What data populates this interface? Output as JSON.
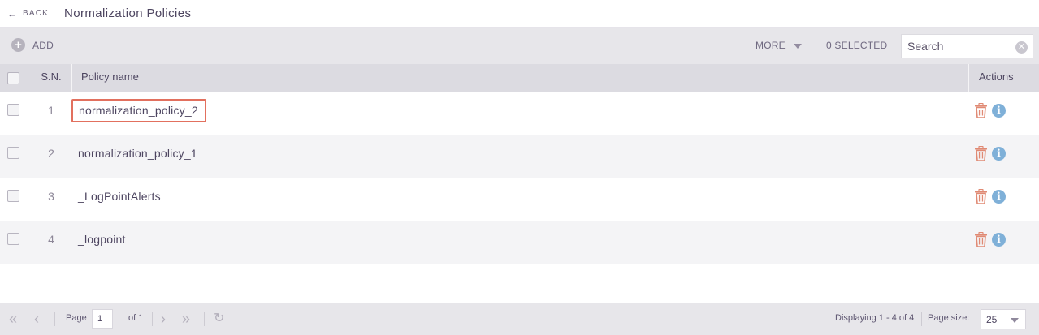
{
  "header": {
    "back_label": "BACK",
    "title": "Normalization Policies"
  },
  "toolbar": {
    "add_label": "ADD",
    "more_label": "MORE",
    "selected_label": "0 SELECTED",
    "search_placeholder": "Search"
  },
  "table": {
    "columns": {
      "sn": "S.N.",
      "name": "Policy name",
      "actions": "Actions"
    },
    "rows": [
      {
        "sn": "1",
        "name": "normalization_policy_2",
        "highlighted": true
      },
      {
        "sn": "2",
        "name": "normalization_policy_1",
        "highlighted": false
      },
      {
        "sn": "3",
        "name": "_LogPointAlerts",
        "highlighted": false
      },
      {
        "sn": "4",
        "name": "_logpoint",
        "highlighted": false
      }
    ],
    "row_actions": [
      "trash-icon",
      "info-icon"
    ]
  },
  "pagination": {
    "page_label": "Page",
    "current_page": "1",
    "of_label": "of 1",
    "displaying": "Displaying 1 - 4 of 4",
    "page_size_label": "Page size:",
    "page_size": "25"
  },
  "colors": {
    "highlight_border": "#e2705e",
    "trash": "#e08a74",
    "info": "#7fb0d8",
    "toolbar_bg": "#e7e6ea",
    "header_row_bg": "#dcdbe1"
  }
}
